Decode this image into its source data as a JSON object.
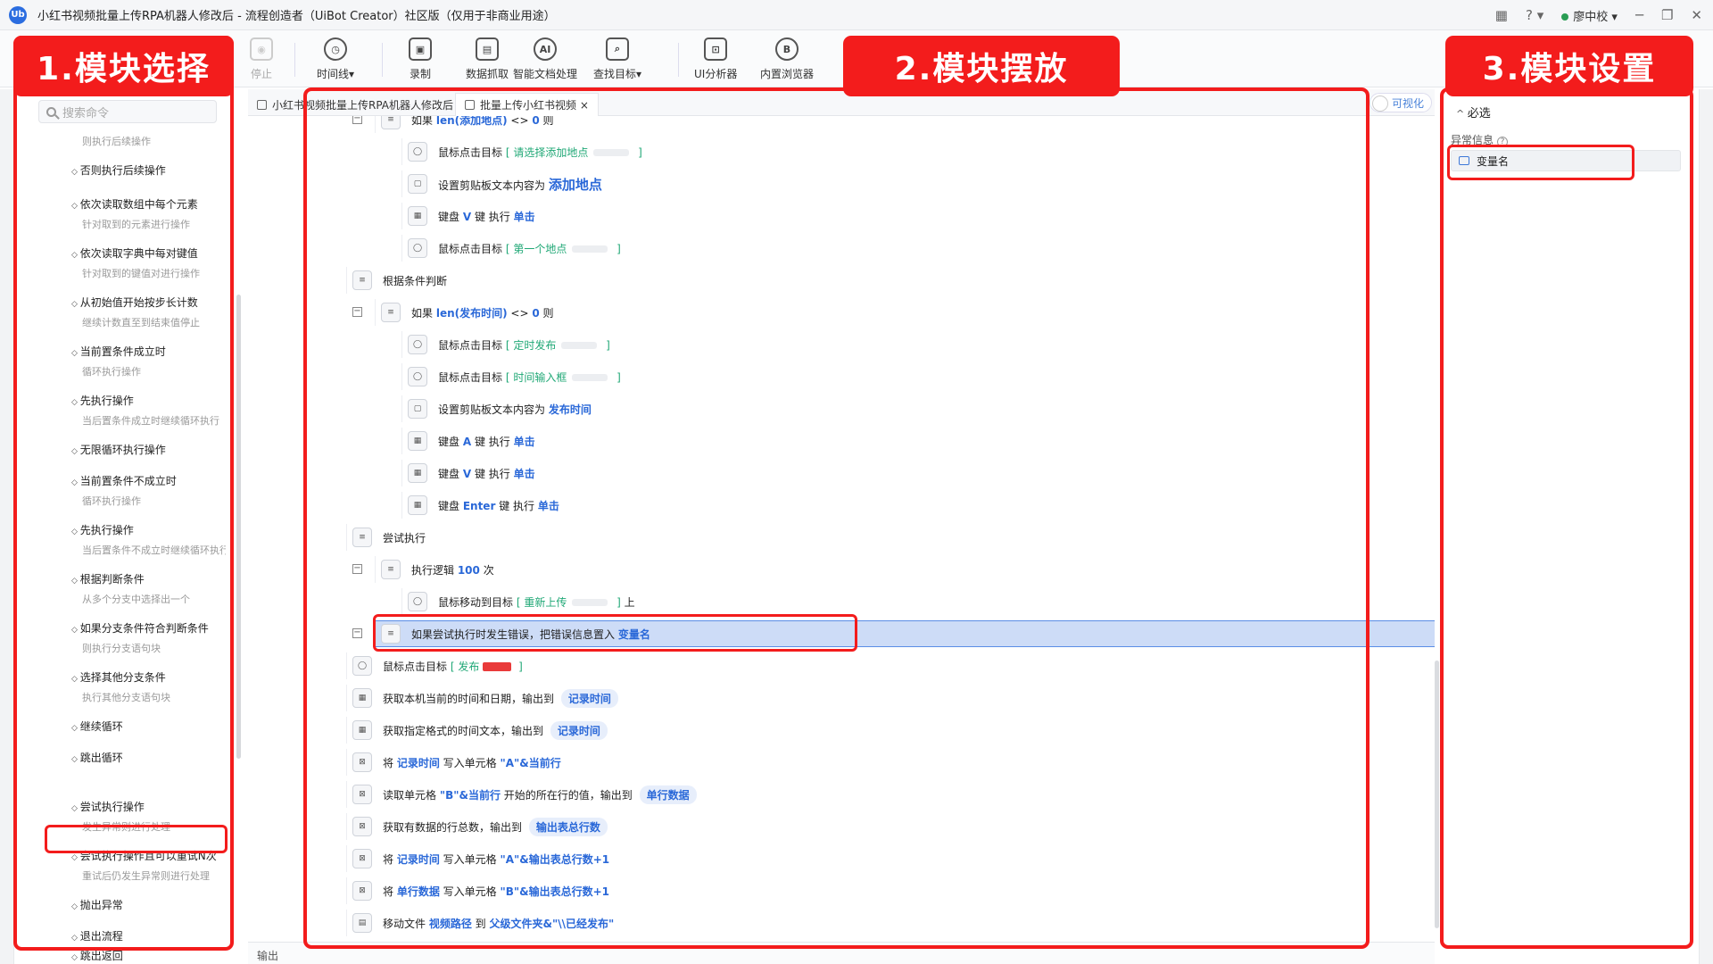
{
  "window": {
    "title": "小红书视频批量上传RPA机器人修改后 - 流程创造者（UiBot Creator）社区版（仅用于非商业用途）",
    "logo": "Ub",
    "user": "廖中校",
    "help_icon": "?"
  },
  "toolbar": {
    "items": [
      {
        "label": "停止",
        "icon": "stop-icon",
        "glyph": "◉"
      },
      {
        "label": "时间线▾",
        "icon": "clock-icon",
        "glyph": "◷"
      },
      {
        "label": "录制",
        "icon": "record-icon",
        "glyph": "▣"
      },
      {
        "label": "数据抓取",
        "icon": "data-grab-icon",
        "glyph": "▤"
      },
      {
        "label": "智能文档处理",
        "icon": "ai-doc-icon",
        "glyph": "AI"
      },
      {
        "label": "查找目标▾",
        "icon": "find-target-icon",
        "glyph": "⌕"
      },
      {
        "label": "UI分析器",
        "icon": "ui-analyzer-icon",
        "glyph": "⊡"
      },
      {
        "label": "内置浏览器",
        "icon": "browser-icon",
        "glyph": "B"
      }
    ]
  },
  "annotations": {
    "label1": "1.模块选择",
    "label2": "2.模块摆放",
    "label3": "3.模块设置"
  },
  "left": {
    "search_placeholder": "搜索命令",
    "commands": [
      {
        "name": "",
        "desc": "则执行后续操作"
      },
      {
        "name": "否则执行后续操作",
        "desc": ""
      },
      {
        "name": "依次读取数组中每个元素",
        "desc": "针对取到的元素进行操作"
      },
      {
        "name": "依次读取字典中每对键值",
        "desc": "针对取到的键值对进行操作"
      },
      {
        "name": "从初始值开始按步长计数",
        "desc": "继续计数直至到结束值停止"
      },
      {
        "name": "当前置条件成立时",
        "desc": "循环执行操作"
      },
      {
        "name": "先执行操作",
        "desc": "当后置条件成立时继续循环执行"
      },
      {
        "name": "无限循环执行操作",
        "desc": ""
      },
      {
        "name": "当前置条件不成立时",
        "desc": "循环执行操作"
      },
      {
        "name": "先执行操作",
        "desc": "当后置条件不成立时继续循环执行"
      },
      {
        "name": "根据判断条件",
        "desc": "从多个分支中选择出一个"
      },
      {
        "name": "如果分支条件符合判断条件",
        "desc": "则执行分支语句块"
      },
      {
        "name": "选择其他分支条件",
        "desc": "执行其他分支语句块"
      },
      {
        "name": "继续循环",
        "desc": ""
      },
      {
        "name": "跳出循环",
        "desc": ""
      },
      {
        "name": "尝试执行操作",
        "desc": "发生异常则进行处理"
      },
      {
        "name": "尝试执行操作且可以重试N次",
        "desc": "重试后仍发生异常则进行处理"
      },
      {
        "name": "抛出异常",
        "desc": ""
      },
      {
        "name": "退出流程",
        "desc": ""
      },
      {
        "name": "跳出返回",
        "desc": ""
      }
    ]
  },
  "tabs": [
    {
      "label": "小红书视频批量上传RPA机器人修改后"
    },
    {
      "label": "批量上传小红书视频 ×"
    }
  ],
  "view_toggle": "可视化",
  "editor": {
    "rows": [
      {
        "ln": "54",
        "indent": 1,
        "fold": true,
        "icon": "≡",
        "parts": [
          [
            "t",
            "如果 "
          ],
          [
            "k",
            "len(添加地点)"
          ],
          [
            "t",
            " <> "
          ],
          [
            "k",
            "0"
          ],
          [
            "t",
            " 则"
          ]
        ]
      },
      {
        "ln": "55",
        "indent": 2,
        "icon": "◯",
        "parts": [
          [
            "t",
            "鼠标点击目标 "
          ],
          [
            "g",
            "[ 请选择添加地点"
          ],
          [
            "b",
            ""
          ],
          [
            "g",
            " ]"
          ]
        ]
      },
      {
        "ln": "56",
        "indent": 2,
        "icon": "▢",
        "parts": [
          [
            "t",
            "设置剪贴板文本内容为 "
          ],
          [
            "big",
            "添加地点"
          ]
        ]
      },
      {
        "ln": "57",
        "indent": 2,
        "icon": "▦",
        "parts": [
          [
            "t",
            "键盘 "
          ],
          [
            "k",
            "V"
          ],
          [
            "t",
            " 键 执行 "
          ],
          [
            "k",
            "单击"
          ]
        ]
      },
      {
        "ln": "58",
        "indent": 2,
        "icon": "◯",
        "parts": [
          [
            "t",
            "鼠标点击目标 "
          ],
          [
            "g",
            "[ 第一个地点"
          ],
          [
            "b",
            ""
          ],
          [
            "g",
            " ]"
          ]
        ]
      },
      {
        "ln": "60",
        "indent": 0,
        "icon": "≡",
        "parts": [
          [
            "t",
            "根据条件判断"
          ]
        ]
      },
      {
        "ln": "60",
        "indent": 1,
        "fold": true,
        "icon": "≡",
        "parts": [
          [
            "t",
            "如果 "
          ],
          [
            "k",
            "len(发布时间)"
          ],
          [
            "t",
            " <> "
          ],
          [
            "k",
            "0"
          ],
          [
            "t",
            " 则"
          ]
        ]
      },
      {
        "ln": "61",
        "indent": 2,
        "icon": "◯",
        "parts": [
          [
            "t",
            "鼠标点击目标 "
          ],
          [
            "g",
            "[ 定时发布"
          ],
          [
            "b",
            ""
          ],
          [
            "g",
            " ]"
          ]
        ]
      },
      {
        "ln": "62",
        "indent": 2,
        "icon": "◯",
        "parts": [
          [
            "t",
            "鼠标点击目标 "
          ],
          [
            "g",
            "[ 时间输入框"
          ],
          [
            "b",
            ""
          ],
          [
            "g",
            " ]"
          ]
        ]
      },
      {
        "ln": "63",
        "indent": 2,
        "icon": "▢",
        "parts": [
          [
            "t",
            "设置剪贴板文本内容为 "
          ],
          [
            "k",
            "发布时间"
          ]
        ]
      },
      {
        "ln": "64",
        "indent": 2,
        "icon": "▦",
        "parts": [
          [
            "t",
            "键盘 "
          ],
          [
            "k",
            "A"
          ],
          [
            "t",
            " 键 执行 "
          ],
          [
            "k",
            "单击"
          ]
        ]
      },
      {
        "ln": "65",
        "indent": 2,
        "icon": "▦",
        "parts": [
          [
            "t",
            "键盘 "
          ],
          [
            "k",
            "V"
          ],
          [
            "t",
            " 键 执行 "
          ],
          [
            "k",
            "单击"
          ]
        ]
      },
      {
        "ln": "66",
        "indent": 2,
        "icon": "▦",
        "parts": [
          [
            "t",
            "键盘 "
          ],
          [
            "k",
            "Enter"
          ],
          [
            "t",
            " 键 执行 "
          ],
          [
            "k",
            "单击"
          ]
        ]
      },
      {
        "ln": "68",
        "indent": 0,
        "icon": "≡",
        "parts": [
          [
            "t",
            "尝试执行"
          ]
        ]
      },
      {
        "ln": "68",
        "indent": 1,
        "fold": true,
        "icon": "≡",
        "parts": [
          [
            "t",
            "执行逻辑 "
          ],
          [
            "k",
            "100"
          ],
          [
            "t",
            " 次"
          ]
        ]
      },
      {
        "ln": "69",
        "indent": 2,
        "icon": "◯",
        "parts": [
          [
            "t",
            "鼠标移动到目标 "
          ],
          [
            "g",
            "[ 重新上传"
          ],
          [
            "b",
            ""
          ],
          [
            "g",
            " ]"
          ],
          [
            "t",
            " 上"
          ]
        ]
      },
      {
        "ln": "70",
        "indent": 1,
        "fold": true,
        "sel": true,
        "icon": "≡",
        "parts": [
          [
            "t",
            "如果尝试执行时发生错误，把错误信息置入 "
          ],
          [
            "k",
            "变量名"
          ]
        ]
      },
      {
        "ln": "72",
        "indent": 0,
        "icon": "◯",
        "parts": [
          [
            "t",
            "鼠标点击目标 "
          ],
          [
            "g",
            "[ 发布"
          ],
          [
            "r",
            ""
          ],
          [
            "g",
            " ]"
          ]
        ]
      },
      {
        "ln": "73",
        "indent": 0,
        "icon": "▦",
        "parts": [
          [
            "t",
            "获取本机当前的时间和日期，输出到 "
          ],
          [
            "p",
            "记录时间"
          ]
        ]
      },
      {
        "ln": "74",
        "indent": 0,
        "icon": "▦",
        "parts": [
          [
            "t",
            "获取指定格式的时间文本，输出到 "
          ],
          [
            "p",
            "记录时间"
          ]
        ]
      },
      {
        "ln": "75",
        "indent": 0,
        "icon": "⊠",
        "parts": [
          [
            "t",
            "将 "
          ],
          [
            "k",
            "记录时间"
          ],
          [
            "t",
            " 写入单元格 "
          ],
          [
            "k",
            "\"A\"&当前行"
          ]
        ]
      },
      {
        "ln": "76",
        "indent": 0,
        "icon": "⊠",
        "parts": [
          [
            "t",
            "读取单元格 "
          ],
          [
            "k",
            "\"B\"&当前行"
          ],
          [
            "t",
            " 开始的所在行的值，输出到 "
          ],
          [
            "p",
            "单行数据"
          ]
        ]
      },
      {
        "ln": "77",
        "indent": 0,
        "icon": "⊠",
        "parts": [
          [
            "t",
            "获取有数据的行总数，输出到 "
          ],
          [
            "p",
            "输出表总行数"
          ]
        ]
      },
      {
        "ln": "78",
        "indent": 0,
        "icon": "⊠",
        "parts": [
          [
            "t",
            "将 "
          ],
          [
            "k",
            "记录时间"
          ],
          [
            "t",
            " 写入单元格 "
          ],
          [
            "k",
            "\"A\"&输出表总行数+1"
          ]
        ]
      },
      {
        "ln": "79",
        "indent": 0,
        "icon": "⊠",
        "parts": [
          [
            "t",
            "将 "
          ],
          [
            "k",
            "单行数据"
          ],
          [
            "t",
            " 写入单元格 "
          ],
          [
            "k",
            "\"B\"&输出表总行数+1"
          ]
        ]
      },
      {
        "ln": "80",
        "indent": 0,
        "icon": "▤",
        "parts": [
          [
            "t",
            "移动文件 "
          ],
          [
            "k",
            "视频路径"
          ],
          [
            "t",
            " 到 "
          ],
          [
            "k",
            "父级文件夹&\"\\\\已经发布\""
          ]
        ]
      }
    ]
  },
  "output_label": "输出",
  "right": {
    "section": "必选",
    "field_label": "异常信息",
    "field_value": "变量名"
  },
  "colors": {
    "accent": "#2a68d8",
    "annotation": "#f31c1c",
    "selection": "#cddcf7"
  }
}
